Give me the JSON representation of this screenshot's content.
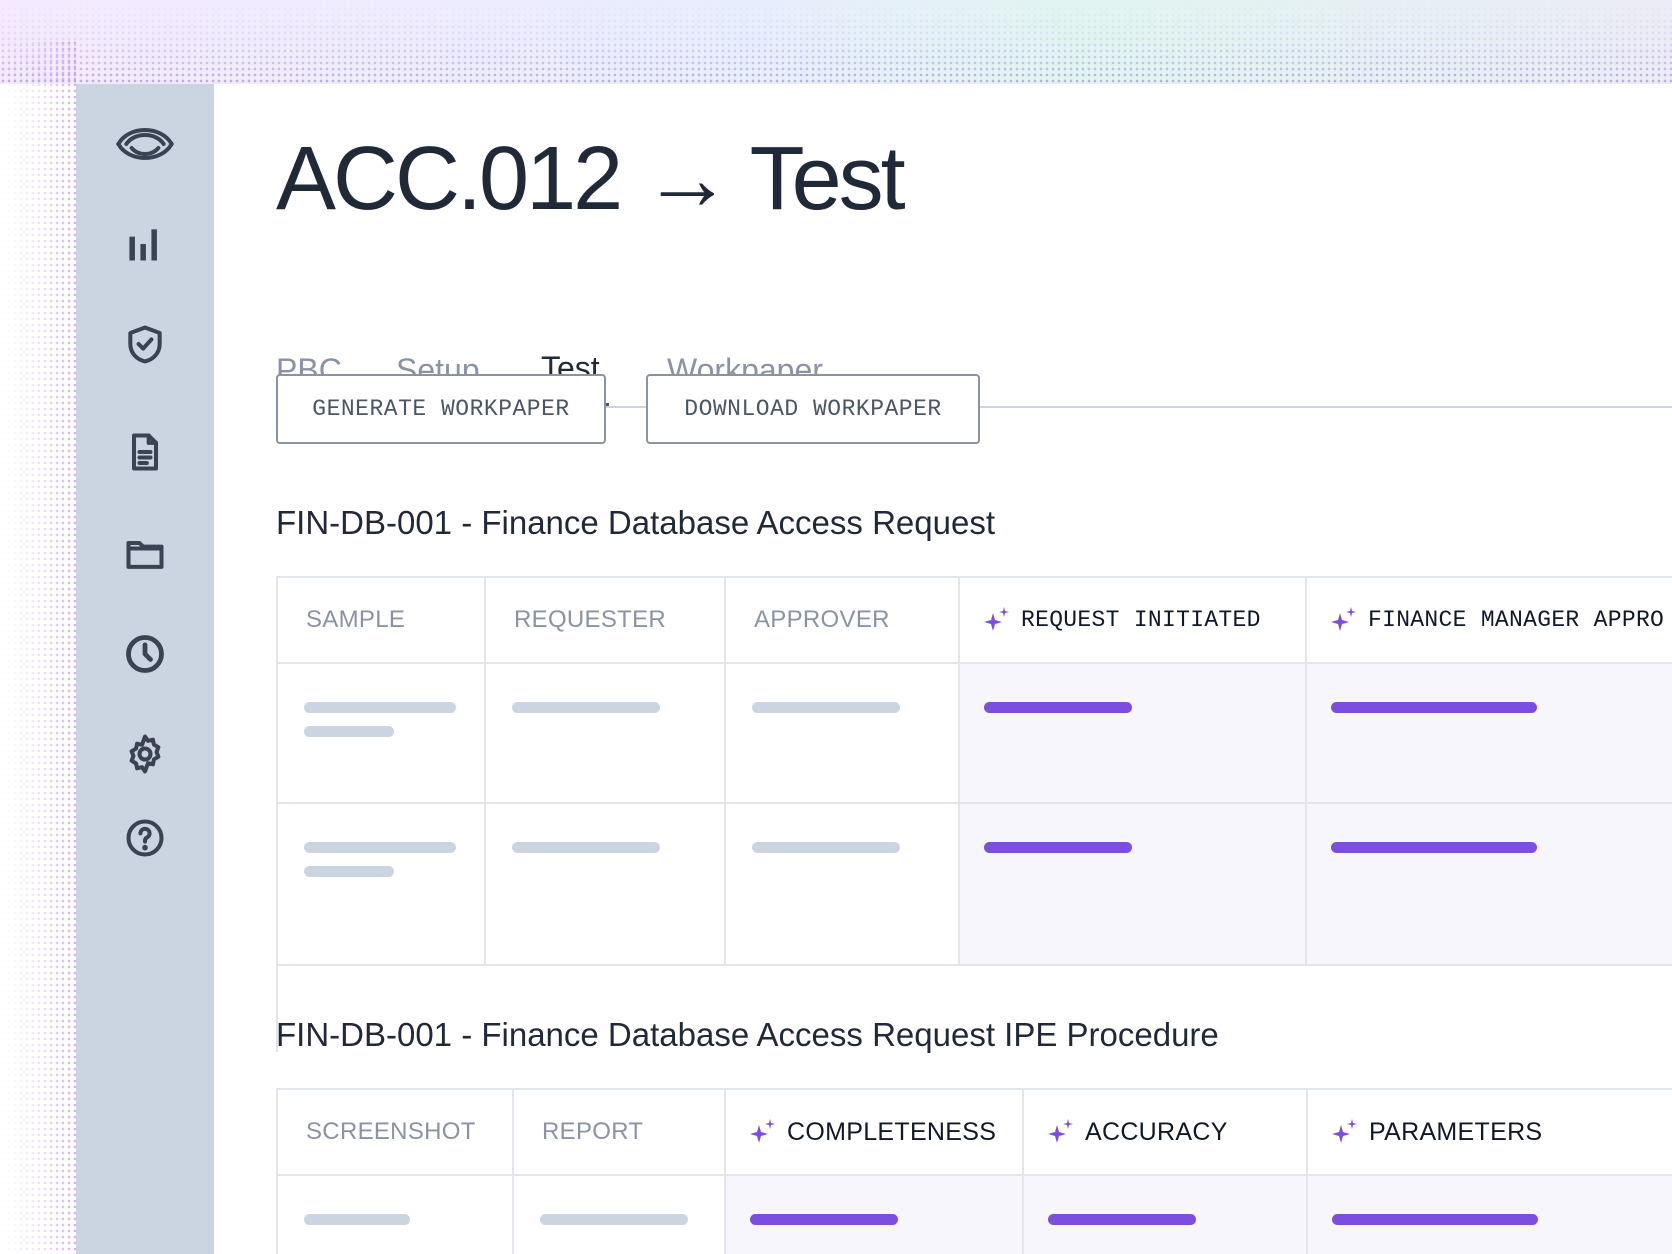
{
  "colors": {
    "sidebar": "#cbd5e1",
    "ai_accent": "#7c4ee0",
    "placeholder": "#cbd5e1",
    "ai_cell_bg": "#f7f6fd"
  },
  "sidebar": {
    "items": [
      {
        "icon": "logo-icon"
      },
      {
        "icon": "bar-chart-icon"
      },
      {
        "icon": "shield-check-icon"
      },
      {
        "icon": "document-icon"
      },
      {
        "icon": "folder-icon"
      },
      {
        "icon": "clock-icon"
      },
      {
        "icon": "gear-icon"
      },
      {
        "icon": "help-icon"
      }
    ]
  },
  "page": {
    "title": "ACC.012 → Test"
  },
  "tabs": [
    {
      "label": "PBC",
      "active": false
    },
    {
      "label": "Setup",
      "active": false
    },
    {
      "label": "Test",
      "active": true
    },
    {
      "label": "Workpaper",
      "active": false
    }
  ],
  "actions": {
    "generate_label": "GENERATE WORKPAPER",
    "download_label": "DOWNLOAD WORKPAPER"
  },
  "table1": {
    "title": "FIN-DB-001 - Finance Database Access Request",
    "columns": [
      {
        "label": "SAMPLE",
        "ai": false
      },
      {
        "label": "REQUESTER",
        "ai": false
      },
      {
        "label": "APPROVER",
        "ai": false
      },
      {
        "label": "REQUEST INITIATED",
        "ai": true
      },
      {
        "label": "FINANCE MANAGER APPRO",
        "ai": true
      }
    ]
  },
  "table2": {
    "title": "FIN-DB-001 - Finance Database Access Request IPE Procedure",
    "columns": [
      {
        "label": "SCREENSHOT",
        "ai": false
      },
      {
        "label": "REPORT",
        "ai": false
      },
      {
        "label": "COMPLETENESS",
        "ai": true
      },
      {
        "label": "ACCURACY",
        "ai": true
      },
      {
        "label": "PARAMETERS",
        "ai": true
      }
    ]
  }
}
